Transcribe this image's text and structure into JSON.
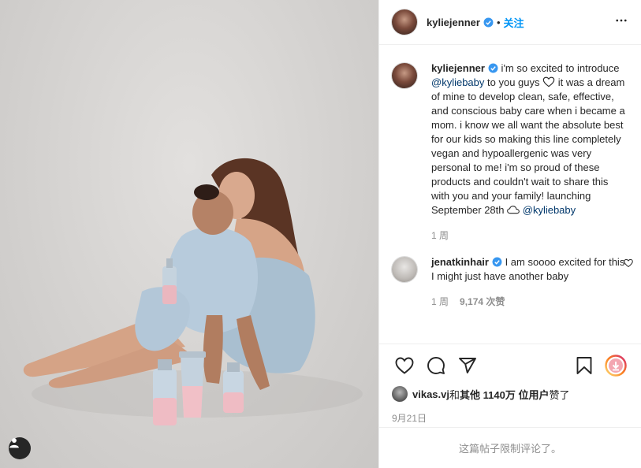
{
  "post": {
    "username": "kyliejenner",
    "follow_label": "关注",
    "dot": "•"
  },
  "caption": {
    "username": "kyliejenner",
    "text_1": " i'm so excited to introduce ",
    "mention_1": "@kyliebaby",
    "text_2": " to you guys ",
    "text_3": " it was a dream of mine to develop clean, safe, effective, and conscious baby care when i became a mom. i know we all want the absolute best for our kids so making this line completely vegan and hypoallergenic was very personal to me! i'm so proud of these products and couldn't wait to share this with you and your family! launching September 28th ",
    "mention_2": "@kyliebaby",
    "time": "1 周"
  },
  "comment": {
    "username": "jenatkinhair",
    "text": " I am soooo excited for this I might just have another baby",
    "time": "1 周",
    "likes": "9,174 次赞"
  },
  "likes": {
    "user": "vikas.vj",
    "t1": " 和 ",
    "others": "其他 1140万 位用户",
    "t2": " 赞了"
  },
  "date": "9月21日",
  "comments_limited": "这篇帖子限制评论了。",
  "colors": {
    "accent": "#0095f6",
    "verified": "#3897f0",
    "muted": "#8e8e8e",
    "mention": "#00376b"
  },
  "icons": [
    "user-tag-icon",
    "verified-icon",
    "more-icon",
    "heart-icon",
    "comment-icon",
    "share-icon",
    "bookmark-icon",
    "story-icon",
    "cloud-icon"
  ]
}
